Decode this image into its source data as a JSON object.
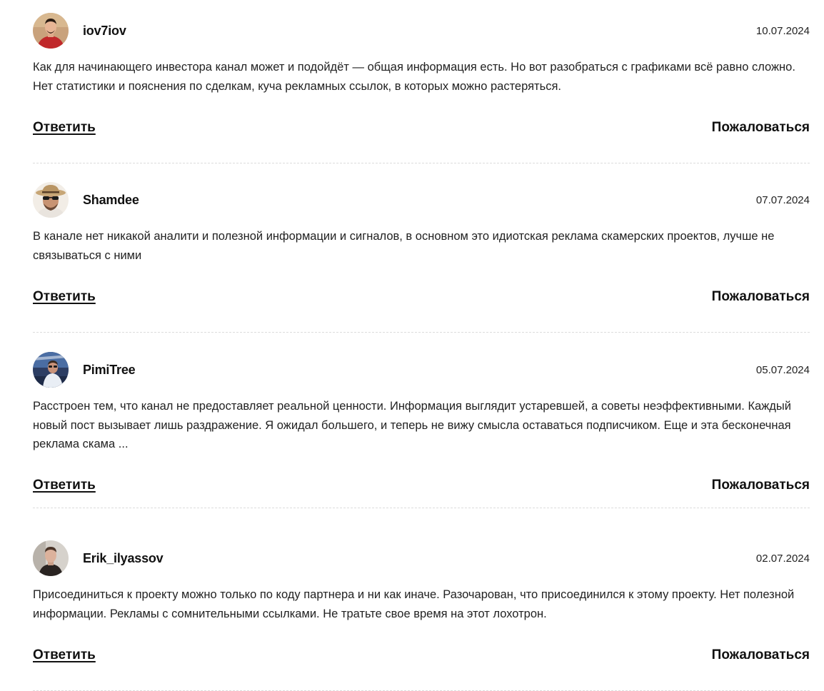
{
  "comments": [
    {
      "username": "iov7iov",
      "date": "10.07.2024",
      "avatar": "avatar-man-red-hoodie",
      "text": "Как для начинающего инвестора канал может и подойдёт — общая информация есть. Но вот разобраться с графиками всё равно сложно. Нет статистики и пояснения по сделкам, куча рекламных ссылок, в которых можно растеряться.",
      "reply_label": "Ответить",
      "report_label": "Пожаловаться"
    },
    {
      "username": "Shamdee",
      "date": "07.07.2024",
      "avatar": "avatar-man-hat-sunglasses",
      "text": "В канале нет никакой аналити и полезной информации и сигналов, в основном это идиотская реклама скамерских проектов, лучше не связываться с ними",
      "reply_label": "Ответить",
      "report_label": "Пожаловаться"
    },
    {
      "username": "PimiTree",
      "date": "05.07.2024",
      "avatar": "avatar-man-boat",
      "text": "Расстроен тем, что канал не предоставляет реальной ценности. Информация выглядит устаревшей, а советы неэффективными. Каждый новый пост вызывает лишь раздражение. Я ожидал большего, и теперь не вижу смысла оставаться подписчиком. Еще и эта бесконечная реклама скама ...",
      "reply_label": "Ответить",
      "report_label": "Пожаловаться"
    },
    {
      "username": "Erik_ilyassov",
      "date": "02.07.2024",
      "avatar": "avatar-man-dark-portrait",
      "text": "Присоединиться к проекту можно только по коду партнера и ни как иначе. Разочарован, что присоединился к этому проекту. Нет полезной информации. Рекламы с сомнительными ссылками. Не тратьте свое время на этот лохотрон.",
      "reply_label": "Ответить",
      "report_label": "Пожаловаться"
    }
  ],
  "colors": {
    "text": "#222222",
    "divider": "#dcdcdc",
    "background": "#ffffff"
  }
}
